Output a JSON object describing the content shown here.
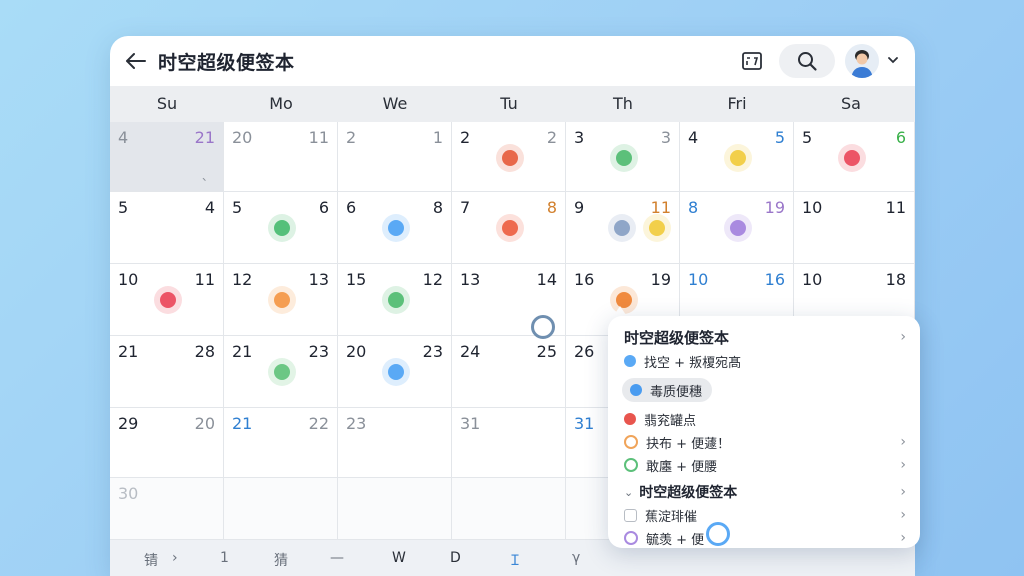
{
  "header": {
    "title": "时空超级便签本"
  },
  "weekdays": [
    "Su",
    "Mo",
    "We",
    "Tu",
    "Th",
    "Fri",
    "Sa"
  ],
  "rows": [
    [
      {
        "l": "4",
        "lc": "gray",
        "r": "21",
        "rc": "purple",
        "shade": true,
        "extra": "、"
      },
      {
        "l": "20",
        "lc": "gray",
        "r": "11",
        "rc": "gray"
      },
      {
        "l": "2",
        "lc": "gray",
        "r": "1",
        "rc": "gray"
      },
      {
        "l": "2",
        "lc": "",
        "r": "2",
        "rc": "gray",
        "dot": "#e8684a"
      },
      {
        "l": "3",
        "lc": "",
        "r": "3",
        "rc": "gray",
        "dot": "#5cc07a"
      },
      {
        "l": "4",
        "lc": "",
        "r": "5",
        "rc": "blue",
        "dot": "#f2cf4a"
      },
      {
        "l": "5",
        "lc": "",
        "r": "6",
        "rc": "green",
        "dot": "#ec5466"
      }
    ],
    [
      {
        "l": "5",
        "lc": "",
        "r": "4",
        "rc": ""
      },
      {
        "l": "5",
        "lc": "",
        "r": "6",
        "rc": "",
        "dot": "#54c07a"
      },
      {
        "l": "6",
        "lc": "",
        "r": "8",
        "rc": "",
        "dot": "#5aa9f5"
      },
      {
        "l": "7",
        "lc": "",
        "r": "8",
        "rc": "orange",
        "dot": "#ee6a4e"
      },
      {
        "l": "9",
        "lc": "",
        "r": "11",
        "rc": "orange",
        "dot": "#8fa6c8",
        "dot2": "#f2cf4a"
      },
      {
        "l": "8",
        "lc": "blue",
        "r": "19",
        "rc": "purple",
        "dot": "#a98ae0"
      },
      {
        "l": "10",
        "lc": "",
        "r": "11",
        "rc": ""
      }
    ],
    [
      {
        "l": "10",
        "lc": "",
        "r": "11",
        "rc": "",
        "dot": "#ec5466"
      },
      {
        "l": "12",
        "lc": "",
        "r": "13",
        "rc": "",
        "dot": "#f59e52"
      },
      {
        "l": "15",
        "lc": "",
        "r": "12",
        "rc": "",
        "dot": "#5cc07a"
      },
      {
        "l": "13",
        "lc": "",
        "r": "14",
        "rc": ""
      },
      {
        "l": "16",
        "lc": "",
        "r": "19",
        "rc": "",
        "dot": "#f08a3e"
      },
      {
        "l": "10",
        "lc": "blue",
        "r": "16",
        "rc": "blue"
      },
      {
        "l": "10",
        "lc": "",
        "r": "18",
        "rc": ""
      }
    ],
    [
      {
        "l": "21",
        "lc": "",
        "r": "28",
        "rc": ""
      },
      {
        "l": "21",
        "lc": "",
        "r": "23",
        "rc": "",
        "dot": "#6cc784"
      },
      {
        "l": "20",
        "lc": "",
        "r": "23",
        "rc": "",
        "dot": "#5aa9f5"
      },
      {
        "l": "24",
        "lc": "",
        "r": "25",
        "rc": ""
      },
      {
        "l": "26",
        "lc": "",
        "r": "",
        "rc": ""
      },
      {
        "l": "",
        "lc": "",
        "r": "",
        "rc": ""
      },
      {
        "l": "",
        "lc": "",
        "r": "",
        "rc": ""
      }
    ],
    [
      {
        "l": "29",
        "lc": "",
        "r": "20",
        "rc": "gray"
      },
      {
        "l": "21",
        "lc": "blue",
        "r": "22",
        "rc": "gray"
      },
      {
        "l": "23",
        "lc": "gray",
        "r": "",
        "rc": ""
      },
      {
        "l": "31",
        "lc": "gray",
        "r": "",
        "rc": ""
      },
      {
        "l": "31",
        "lc": "blue",
        "r": "",
        "rc": ""
      },
      {
        "l": "",
        "lc": "",
        "r": "",
        "rc": ""
      },
      {
        "l": "",
        "lc": "",
        "r": "",
        "rc": ""
      }
    ],
    [
      {
        "l": "30",
        "lc": "lightgray",
        "r": "",
        "rc": "",
        "faded": true
      },
      {
        "l": "",
        "lc": "",
        "r": "",
        "rc": "",
        "faded": true
      },
      {
        "l": "",
        "lc": "",
        "r": "",
        "rc": "",
        "faded": true
      },
      {
        "l": "",
        "lc": "",
        "r": "",
        "rc": "",
        "faded": true
      },
      {
        "l": "",
        "lc": "",
        "r": "",
        "rc": "",
        "faded": true
      },
      {
        "l": "",
        "lc": "",
        "r": "",
        "rc": "",
        "faded": true
      },
      {
        "l": "",
        "lc": "",
        "r": "",
        "rc": "",
        "faded": true
      }
    ]
  ],
  "bottom_bar": [
    "锖",
    "›",
    "1",
    "猜",
    "—",
    "W",
    "D",
    "Ｉ",
    "γ"
  ],
  "popup": {
    "title": "时空超级便签本",
    "items": [
      {
        "type": "cdot",
        "color": "#5aa9f5",
        "label": "找空 + 叛榎宛髙",
        "arrow": false
      },
      {
        "type": "pill",
        "color": "#4a9cf0",
        "label": "毒质便穗",
        "arrow": false
      },
      {
        "type": "cdot",
        "color": "#e8554e",
        "label": "翡兖罐点",
        "arrow": false
      },
      {
        "type": "cring",
        "color": "#f0a45a",
        "label": "抉布 + 便蘧！",
        "arrow": true
      },
      {
        "type": "cring",
        "color": "#5cc07a",
        "label": "敢廛 + 便腰",
        "arrow": true
      }
    ],
    "section_title": "时空超级便签本",
    "section_items": [
      {
        "type": "cbox",
        "color": "#b8bdc4",
        "label": "蕉淀琲催",
        "arrow": true
      },
      {
        "type": "cring",
        "color": "#a98ae0",
        "label": "毓羡 + 便",
        "arrow": true
      }
    ]
  }
}
